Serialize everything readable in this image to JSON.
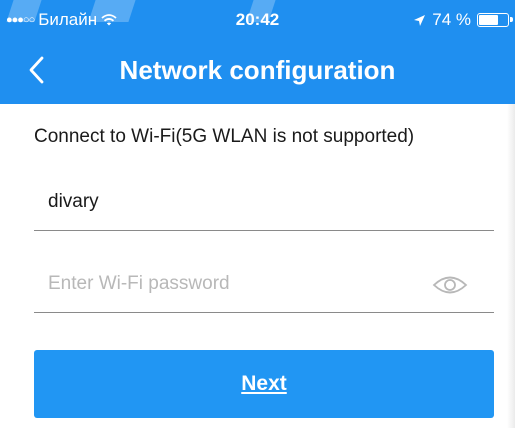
{
  "status_bar": {
    "signal_dots": "●●●○○",
    "carrier": "Билайн",
    "wifi_icon": "wifi-icon",
    "time": "20:42",
    "location_icon": "location-arrow-icon",
    "battery_text": "74 %",
    "battery_level": 0.74
  },
  "nav": {
    "back_icon": "chevron-left-icon",
    "title": "Network configuration"
  },
  "form": {
    "instruction": "Connect to Wi-Fi(5G WLAN is not supported)",
    "ssid_value": "divary",
    "password_placeholder": "Enter Wi-Fi password",
    "password_value": "",
    "eye_icon": "eye-icon",
    "next_label": "Next"
  },
  "colors": {
    "header_blue": "#1f8ff0",
    "button_blue": "#2196f3",
    "underline_gray": "#8a8a8a",
    "placeholder_gray": "#b8b8b8"
  }
}
